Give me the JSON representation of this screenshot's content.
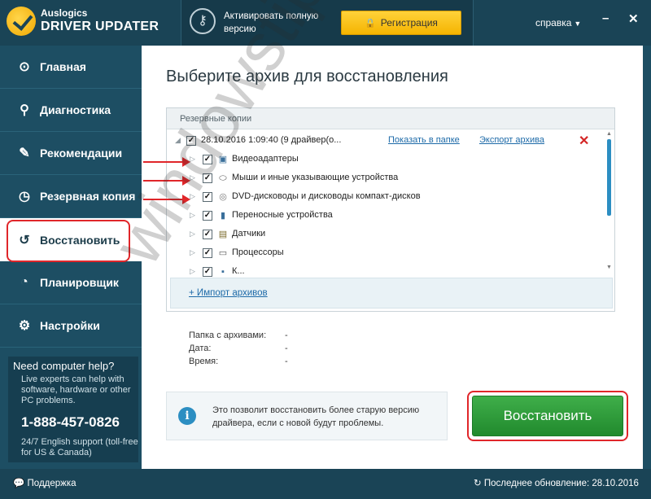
{
  "header": {
    "brand_small": "Auslogics",
    "brand_big": "DRIVER UPDATER",
    "activate_text": "Активировать полную версию",
    "register_label": "Регистрация",
    "help_menu": "справка",
    "minimize": "–",
    "close": "✕"
  },
  "sidebar": {
    "items": [
      {
        "label": "Главная",
        "icon": "home-icon"
      },
      {
        "label": "Диагностика",
        "icon": "search-icon"
      },
      {
        "label": "Рекомендации",
        "icon": "wrench-icon"
      },
      {
        "label": "Резервная копия",
        "icon": "backup-icon"
      },
      {
        "label": "Восстановить",
        "icon": "restore-icon"
      },
      {
        "label": "Планировщик",
        "icon": "clock-icon"
      },
      {
        "label": "Настройки",
        "icon": "gear-icon"
      }
    ],
    "help": {
      "title": "Need computer help?",
      "desc": "Live experts can help with software, hardware or other PC problems.",
      "phone": "1-888-457-0826",
      "support": "24/7 English support (toll-free for US & Canada)"
    }
  },
  "main": {
    "title": "Выберите архив для восстановления",
    "backup_header": "Резервные копии",
    "archive": {
      "name": "28.10.2016 1:09:40 (9 драйвер(о...",
      "show_in_folder": "Показать в папке",
      "export": "Экспорт архива"
    },
    "devices": [
      {
        "label": "Видеоадаптеры",
        "icon": "display-icon"
      },
      {
        "label": "Мыши и иные указывающие устройства",
        "icon": "mouse-icon"
      },
      {
        "label": "DVD-дисководы и дисководы компакт-дисков",
        "icon": "disc-icon"
      },
      {
        "label": "Переносные устройства",
        "icon": "portable-device-icon"
      },
      {
        "label": "Датчики",
        "icon": "sensor-icon"
      },
      {
        "label": "Процессоры",
        "icon": "cpu-icon"
      },
      {
        "label": "К...",
        "icon": "device-icon"
      }
    ],
    "import_link": "Импорт архивов",
    "info": {
      "folder_label": "Папка с архивами:",
      "folder_value": "-",
      "date_label": "Дата:",
      "date_value": "-",
      "time_label": "Время:",
      "time_value": "-"
    },
    "notice": "Это позволит восстановить более старую версию драйвера, если с новой будут проблемы.",
    "restore_button": "Восстановить"
  },
  "footer": {
    "support": "Поддержка",
    "last_update": "Последнее обновление: 28.10.2016"
  },
  "watermark": "windowstips.ru",
  "colors": {
    "sidebar_bg": "#1d4e63",
    "accent_yellow": "#f5b400",
    "restore_green": "#2a9a37",
    "annotation_red": "#e0262a",
    "link_blue": "#1d6aa8"
  }
}
